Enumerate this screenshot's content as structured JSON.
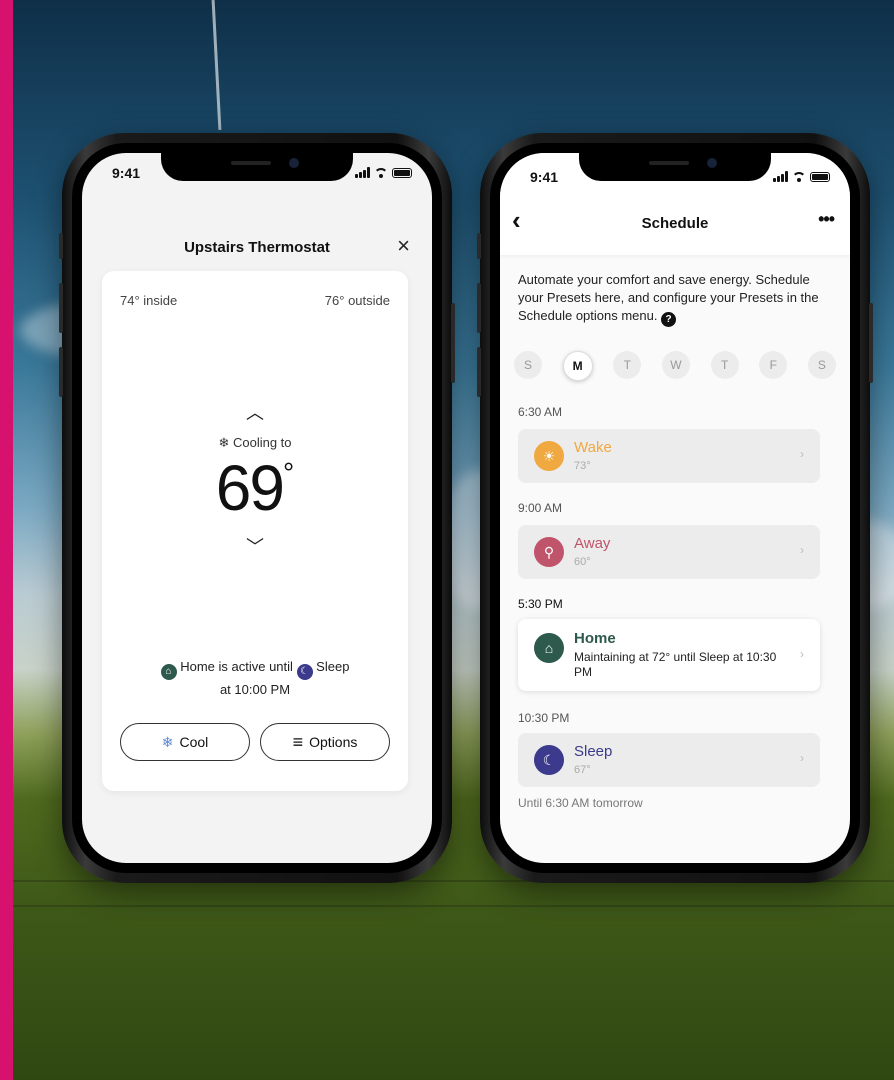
{
  "colors": {
    "accent": "#d6126e",
    "home": "#2e5a4e",
    "sleep": "#3b3a8c",
    "wake": "#f0a840",
    "away": "#c0546b",
    "cool": "#5a86d6"
  },
  "thermostat": {
    "status_time": "9:41",
    "title": "Upstairs Thermostat",
    "close_icon": "×",
    "inside": "74° inside",
    "outside": "76° outside",
    "increase_icon": "︿",
    "mode_icon": "❄",
    "mode_text": "Cooling to",
    "setpoint": "69",
    "degree": "°",
    "decrease_icon": "﹀",
    "status_prefix": "Home is active until",
    "status_next": "Sleep",
    "status_suffix": "at 10:00 PM",
    "home_icon": "⌂",
    "sleep_icon": "☾",
    "cool_icon": "❄",
    "cool_button": "Cool",
    "options_icon": "≡",
    "options_button": "Options"
  },
  "schedule": {
    "status_time": "9:41",
    "back_icon": "‹",
    "title": "Schedule",
    "more_icon": "•••",
    "intro": "Automate your comfort and save energy. Schedule your Presets here, and configure your Presets in the Schedule options menu.",
    "help_icon": "?",
    "days": [
      "S",
      "M",
      "T",
      "W",
      "T",
      "F",
      "S"
    ],
    "selected_day": "M",
    "entries": [
      {
        "time": "6:30 AM",
        "name": "Wake",
        "sub": "73°",
        "icon": "☀",
        "chevron": "›"
      },
      {
        "time": "9:00 AM",
        "name": "Away",
        "sub": "60°",
        "icon": "⚲",
        "chevron": "›"
      },
      {
        "time": "5:30 PM",
        "name": "Home",
        "sub": "Maintaining at 72° until Sleep at 10:30 PM",
        "icon": "⌂",
        "chevron": "›"
      },
      {
        "time": "10:30 PM",
        "name": "Sleep",
        "sub": "67°",
        "icon": "☾",
        "chevron": "›"
      }
    ],
    "until": "Until 6:30 AM tomorrow"
  }
}
